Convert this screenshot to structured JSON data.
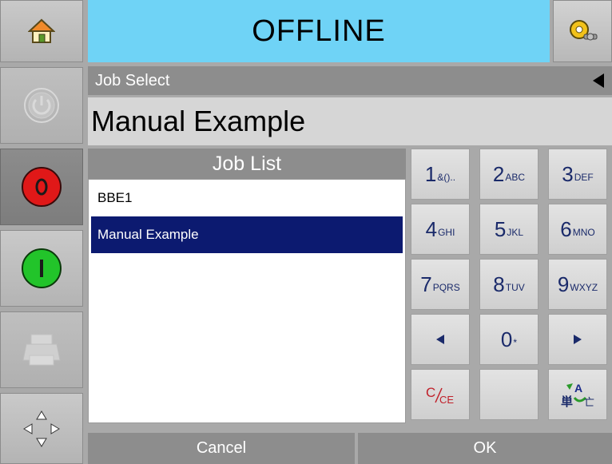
{
  "header": {
    "status": "OFFLINE"
  },
  "job_select": {
    "label": "Job Select",
    "current_job": "Manual Example"
  },
  "job_list": {
    "title": "Job List",
    "items": [
      {
        "label": "BBE1",
        "selected": false
      },
      {
        "label": "Manual Example",
        "selected": true
      }
    ]
  },
  "keypad": {
    "keys": [
      {
        "big": "1",
        "small": "&()..",
        "name": "key-1"
      },
      {
        "big": "2",
        "small": "ABC",
        "name": "key-2"
      },
      {
        "big": "3",
        "small": "DEF",
        "name": "key-3"
      },
      {
        "big": "4",
        "small": "GHI",
        "name": "key-4"
      },
      {
        "big": "5",
        "small": "JKL",
        "name": "key-5"
      },
      {
        "big": "6",
        "small": "MNO",
        "name": "key-6"
      },
      {
        "big": "7",
        "small": "PQRS",
        "name": "key-7"
      },
      {
        "big": "8",
        "small": "TUV",
        "name": "key-8"
      },
      {
        "big": "9",
        "small": "WXYZ",
        "name": "key-9"
      },
      {
        "big": "0",
        "small": "*",
        "name": "key-0"
      }
    ],
    "clear_label": "C/CE"
  },
  "footer": {
    "cancel_label": "Cancel",
    "ok_label": "OK"
  },
  "colors": {
    "header_bg": "#6fd3f6",
    "selected_row": "#0c1a70",
    "stop_button": "#e01818",
    "start_button": "#22c42a"
  }
}
